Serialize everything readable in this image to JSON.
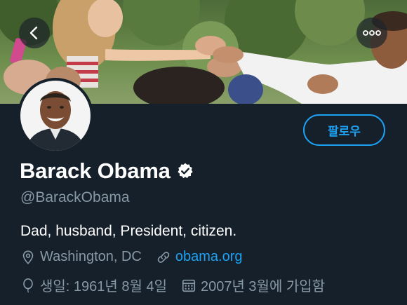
{
  "header": {
    "back_icon": "chevron-left-icon",
    "more_icon": "more-horizontal-icon"
  },
  "profile": {
    "display_name": "Barack Obama",
    "verified": true,
    "handle": "@BarackObama",
    "bio": "Dad, husband, President, citizen.",
    "location": "Washington, DC",
    "website": "obama.org",
    "birthday": "생일: 1961년 8월 4일",
    "joined": "2007년 3월에 가입함"
  },
  "actions": {
    "follow_label": "팔로우"
  },
  "icons": {
    "location": "location-pin-icon",
    "website": "link-icon",
    "birthday": "balloon-icon",
    "joined": "calendar-icon"
  },
  "colors": {
    "background": "#15202b",
    "accent": "#1da1f2",
    "secondary_text": "#8899a6",
    "primary_text": "#ffffff"
  }
}
